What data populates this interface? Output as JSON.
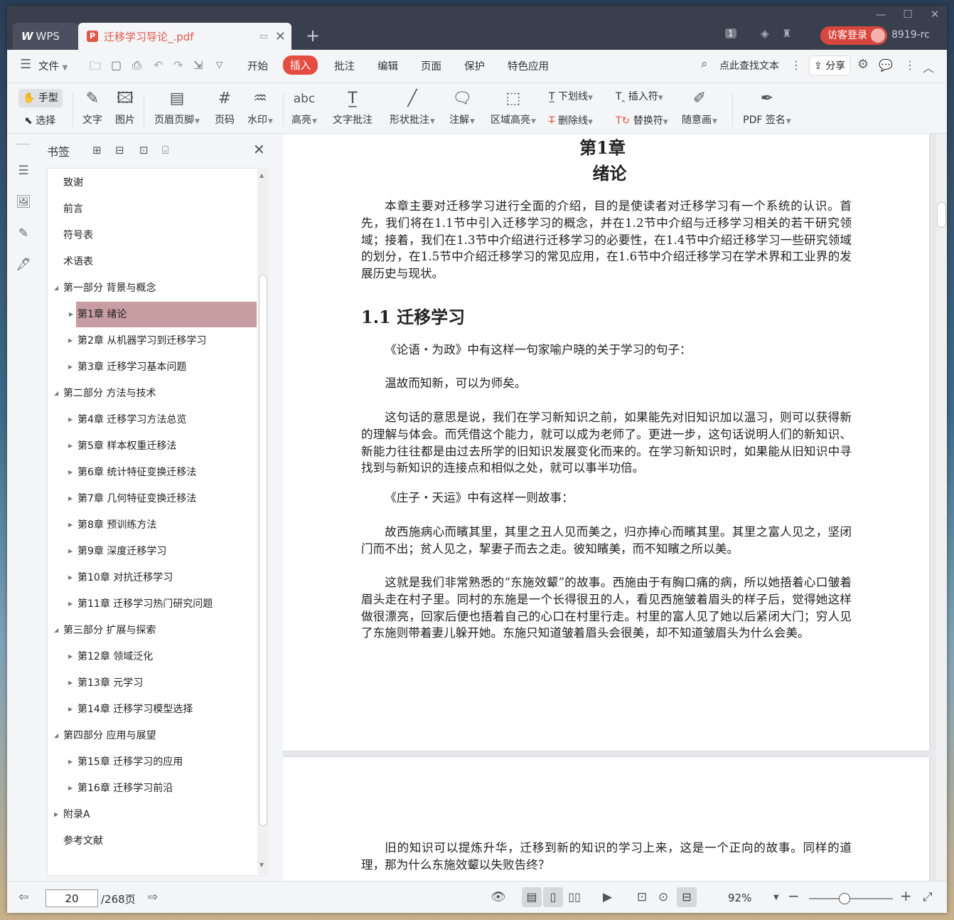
{
  "titlebar": {
    "wps_tab": "WPS",
    "doc_tab": "迁移学习导论_.pdf",
    "page_count_badge": "1",
    "login": "访客登录",
    "user_id": "8919-rc"
  },
  "menu": {
    "file": "文件",
    "items": [
      "开始",
      "插入",
      "批注",
      "编辑",
      "页面",
      "保护",
      "特色应用"
    ],
    "active": "插入",
    "search": "点此查找文本",
    "share": "分享"
  },
  "ribbon": {
    "hand": "手型",
    "select": "选择",
    "text": "文字",
    "image": "图片",
    "header_footer": "页眉页脚",
    "page_num": "页码",
    "watermark": "水印",
    "highlight": "高亮",
    "text_comment": "文字批注",
    "shape_comment": "形状批注",
    "note": "注解",
    "area_highlight": "区域高亮",
    "underline": "下划线",
    "strikethrough": "删除线",
    "insert_mark": "插入符",
    "replace_mark": "替换符",
    "freehand": "随意画",
    "pdf_sign": "PDF 签名"
  },
  "bookmarks": {
    "title": "书签",
    "items": [
      {
        "label": "致谢",
        "level": 0,
        "expander": "none"
      },
      {
        "label": "前言",
        "level": 0,
        "expander": "none"
      },
      {
        "label": "符号表",
        "level": 0,
        "expander": "none"
      },
      {
        "label": "术语表",
        "level": 0,
        "expander": "none"
      },
      {
        "label": "第一部分  背景与概念",
        "level": 0,
        "expander": "open"
      },
      {
        "label": "第1章  绪论",
        "level": 1,
        "expander": "closed",
        "selected": true
      },
      {
        "label": "第2章  从机器学习到迁移学习",
        "level": 1,
        "expander": "closed"
      },
      {
        "label": "第3章  迁移学习基本问题",
        "level": 1,
        "expander": "closed"
      },
      {
        "label": "第二部分  方法与技术",
        "level": 0,
        "expander": "open"
      },
      {
        "label": "第4章  迁移学习方法总览",
        "level": 1,
        "expander": "closed"
      },
      {
        "label": "第5章  样本权重迁移法",
        "level": 1,
        "expander": "closed"
      },
      {
        "label": "第6章  统计特征变换迁移法",
        "level": 1,
        "expander": "closed"
      },
      {
        "label": "第7章  几何特征变换迁移法",
        "level": 1,
        "expander": "closed"
      },
      {
        "label": "第8章  预训练方法",
        "level": 1,
        "expander": "closed"
      },
      {
        "label": "第9章  深度迁移学习",
        "level": 1,
        "expander": "closed"
      },
      {
        "label": "第10章  对抗迁移学习",
        "level": 1,
        "expander": "closed"
      },
      {
        "label": "第11章  迁移学习热门研究问题",
        "level": 1,
        "expander": "closed"
      },
      {
        "label": "第三部分  扩展与探索",
        "level": 0,
        "expander": "open"
      },
      {
        "label": "第12章  领域泛化",
        "level": 1,
        "expander": "closed"
      },
      {
        "label": "第13章  元学习",
        "level": 1,
        "expander": "closed"
      },
      {
        "label": "第14章  迁移学习模型选择",
        "level": 1,
        "expander": "closed"
      },
      {
        "label": "第四部分  应用与展望",
        "level": 0,
        "expander": "open"
      },
      {
        "label": "第15章  迁移学习的应用",
        "level": 1,
        "expander": "closed"
      },
      {
        "label": "第16章  迁移学习前沿",
        "level": 1,
        "expander": "closed"
      },
      {
        "label": "附录A",
        "level": 0,
        "expander": "closed"
      },
      {
        "label": "参考文献",
        "level": 0,
        "expander": "none"
      }
    ]
  },
  "document": {
    "chapter_title": "第1章",
    "chapter_subtitle": "绪论",
    "intro": "本章主要对迁移学习进行全面的介绍，目的是使读者对迁移学习有一个系统的认识。首先，我们将在1.1节中引入迁移学习的概念，并在1.2节中介绍与迁移学习相关的若干研究领域；接着，我们在1.3节中介绍进行迁移学习的必要性，在1.4节中介绍迁移学习一些研究领域的划分，在1.5节中介绍迁移学习的常见应用，在1.6节中介绍迁移学习在学术界和工业界的发展历史与现状。",
    "section_title": "1.1  迁移学习",
    "p1": "《论语・为政》中有这样一句家喻户晓的关于学习的句子：",
    "p2": "温故而知新，可以为师矣。",
    "p3": "这句话的意思是说，我们在学习新知识之前，如果能先对旧知识加以温习，则可以获得新的理解与体会。而凭借这个能力，就可以成为老师了。更进一步，这句话说明人们的新知识、新能力往往都是由过去所学的旧知识发展变化而来的。在学习新知识时，如果能从旧知识中寻找到与新知识的连接点和相似之处，就可以事半功倍。",
    "p4": "《庄子・天运》中有这样一则故事：",
    "p5": "故西施病心而矉其里，其里之丑人见而美之，归亦捧心而矉其里。其里之富人见之，坚闭门而不出；贫人见之，挈妻子而去之走。彼知矉美，而不知矉之所以美。",
    "p6": "这就是我们非常熟悉的“东施效颦”的故事。西施由于有胸口痛的病，所以她捂着心口皱着眉头走在村子里。同村的东施是一个长得很丑的人，看见西施皱着眉头的样子后，觉得她这样做很漂亮，回家后便也捂着自己的心口在村里行走。村里的富人见了她以后紧闭大门；穷人见了东施则带着妻儿躲开她。东施只知道皱着眉头会很美，却不知道皱眉头为什么会美。",
    "p7": "旧的知识可以提炼升华，迁移到新的知识的学习上来，这是一个正向的故事。同样的道理，那为什么东施效颦以失败告终？"
  },
  "status": {
    "current_page": "20",
    "total_pages": "/268页",
    "zoom": "92%",
    "zoom_fraction": 0.42
  },
  "colors": {
    "accent": "#e54d42",
    "selected_bookmark": "#c79da1",
    "titlebar": "#3a3f4d"
  }
}
